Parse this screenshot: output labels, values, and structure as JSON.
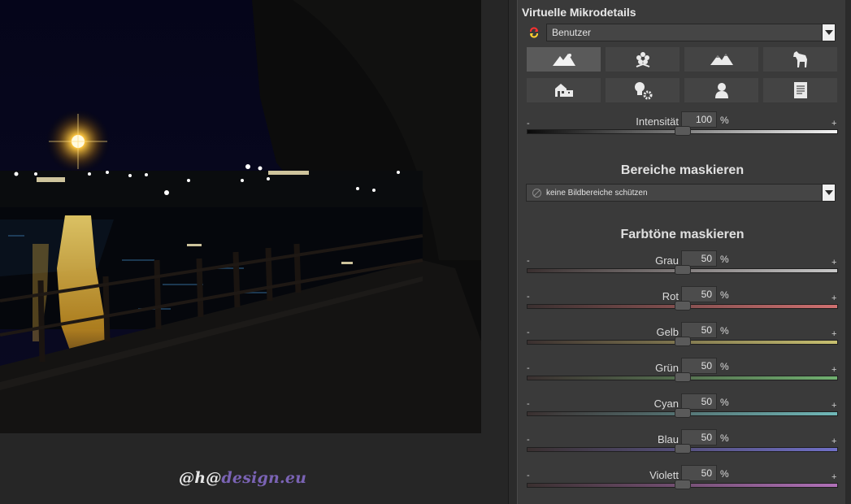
{
  "panel": {
    "title": "Virtuelle Mikrodetails",
    "preset": {
      "value": "Benutzer"
    },
    "icon_buttons": [
      {
        "name": "landscape-icon",
        "active": true
      },
      {
        "name": "flower-icon",
        "active": false
      },
      {
        "name": "mountain-icon",
        "active": false
      },
      {
        "name": "horse-icon",
        "active": false
      },
      {
        "name": "buildings-icon",
        "active": false
      },
      {
        "name": "lightbulb-gear-icon",
        "active": false
      },
      {
        "name": "portrait-icon",
        "active": false
      },
      {
        "name": "document-icon",
        "active": false
      }
    ],
    "intensity": {
      "label": "Intensität",
      "value": "100",
      "unit": "%",
      "minus": "-",
      "plus": "+",
      "level": 0.5
    },
    "mask_areas": {
      "heading": "Bereiche maskieren",
      "value": "keine Bildbereiche schützen"
    },
    "mask_tones": {
      "heading": "Farbtöne maskieren",
      "sliders": [
        {
          "key": "grau",
          "label": "Grau",
          "value": "50",
          "unit": "%",
          "minus": "-",
          "plus": "+",
          "level": 0.5,
          "color": "#c8c8c8"
        },
        {
          "key": "rot",
          "label": "Rot",
          "value": "50",
          "unit": "%",
          "minus": "-",
          "plus": "+",
          "level": 0.5,
          "color": "#d07070"
        },
        {
          "key": "gelb",
          "label": "Gelb",
          "value": "50",
          "unit": "%",
          "minus": "-",
          "plus": "+",
          "level": 0.5,
          "color": "#c8c070"
        },
        {
          "key": "gruen",
          "label": "Grün",
          "value": "50",
          "unit": "%",
          "minus": "-",
          "plus": "+",
          "level": 0.5,
          "color": "#70b070"
        },
        {
          "key": "cyan",
          "label": "Cyan",
          "value": "50",
          "unit": "%",
          "minus": "-",
          "plus": "+",
          "level": 0.5,
          "color": "#70b8b8"
        },
        {
          "key": "blau",
          "label": "Blau",
          "value": "50",
          "unit": "%",
          "minus": "-",
          "plus": "+",
          "level": 0.5,
          "color": "#7070c8"
        },
        {
          "key": "violett",
          "label": "Violett",
          "value": "50",
          "unit": "%",
          "minus": "-",
          "plus": "+",
          "level": 0.5,
          "color": "#b070b8"
        }
      ]
    }
  },
  "watermark": {
    "part1": "@h@",
    "part2": "design.eu"
  }
}
